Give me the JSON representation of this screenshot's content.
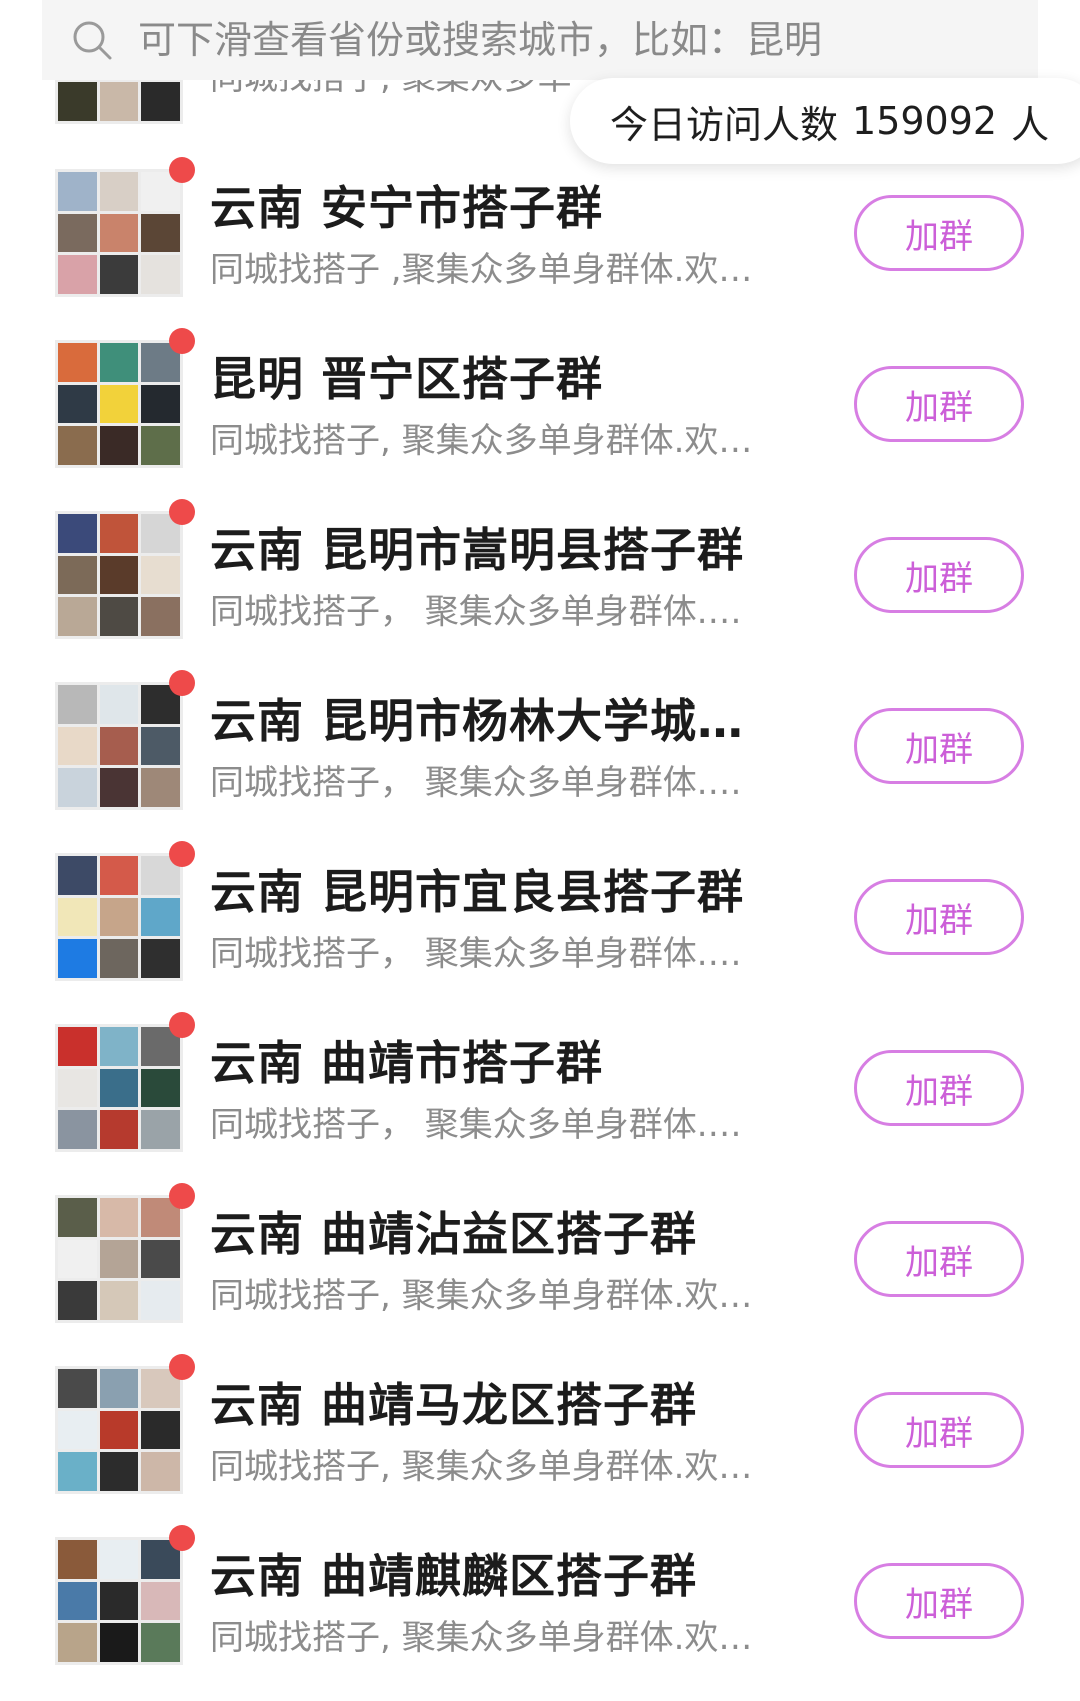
{
  "search": {
    "placeholder": "可下滑查看省份或搜索城市，比如：昆明"
  },
  "visitor": {
    "prefix": "今日访问人数",
    "count": "159092",
    "unit": "人"
  },
  "partial_row": {
    "subtitle": "同城找搭子, 聚集众多单"
  },
  "join_label": "加群",
  "colors": {
    "accent": "#cc5fd8",
    "button_border": "#d77ee3",
    "unread_dot": "#ee4a4a",
    "subtitle": "#8c8c8c"
  },
  "groups": [
    {
      "title": "云南 安宁市搭子群",
      "subtitle": "同城找搭子 ,聚集众多单身群体.欢迎加入",
      "avatar_colors": [
        "#9fb3c9",
        "#d8cfc6",
        "#f0f0f0",
        "#7a6a5e",
        "#c9836b",
        "#5b4636",
        "#d9a2a8",
        "#3b3b3b",
        "#e5e2de"
      ]
    },
    {
      "title": "昆明 晋宁区搭子群",
      "subtitle": "同城找搭子, 聚集众多单身群体.欢迎加入",
      "avatar_colors": [
        "#d96b3c",
        "#3f8f7a",
        "#6d7b86",
        "#2f3a46",
        "#f2d23a",
        "#24292f",
        "#8a6c4e",
        "#3a2a26",
        "#5e6e4a"
      ]
    },
    {
      "title": "云南 昆明市嵩明县搭子群",
      "subtitle": "同城找搭子，  聚集众多单身群体.欢迎加入",
      "avatar_colors": [
        "#3b4a7a",
        "#c0543a",
        "#d6d6d6",
        "#7c6a58",
        "#5a3b2a",
        "#e7ddd0",
        "#b9a896",
        "#4e4a44",
        "#8a7060"
      ]
    },
    {
      "title": "云南 昆明市杨林大学城搭子群",
      "subtitle": "同城找搭子，  聚集众多单身群体.欢迎加入",
      "avatar_colors": [
        "#b8b8b8",
        "#dfe6ea",
        "#2d2d2d",
        "#e8d9c8",
        "#a65d4e",
        "#4d5a66",
        "#c9d3dc",
        "#4a3434",
        "#9e8878"
      ]
    },
    {
      "title": "云南 昆明市宜良县搭子群",
      "subtitle": "同城找搭子，  聚集众多单身群体.欢迎加入",
      "avatar_colors": [
        "#3d4a66",
        "#d45a4a",
        "#d8d8d8",
        "#f1e7b8",
        "#c6a58a",
        "#5fa7c9",
        "#1e7be3",
        "#6d665e",
        "#2f2f2f"
      ]
    },
    {
      "title": "云南 曲靖市搭子群",
      "subtitle": "同城找搭子，  聚集众多单身群体.欢迎加入",
      "avatar_colors": [
        "#c9302c",
        "#7fb3c8",
        "#6a6a6a",
        "#e8e6e3",
        "#3a6e8a",
        "#2a4a3a",
        "#8a94a0",
        "#b63a2e",
        "#9aa3a8"
      ]
    },
    {
      "title": "云南 曲靖沾益区搭子群",
      "subtitle": "同城找搭子, 聚集众多单身群体.欢迎加入",
      "avatar_colors": [
        "#5a5e4a",
        "#d7b9a8",
        "#c08a78",
        "#f0f0f0",
        "#b4a496",
        "#4a4a4a",
        "#3a3a3a",
        "#d5c8b8",
        "#e6ebef"
      ]
    },
    {
      "title": "云南 曲靖马龙区搭子群",
      "subtitle": "同城找搭子, 聚集众多单身群体.欢迎加入",
      "avatar_colors": [
        "#4a4a4a",
        "#8aa0b0",
        "#d8c8bc",
        "#e8eef2",
        "#b83a2a",
        "#2a2a2a",
        "#6ab0c8",
        "#2c2c2c",
        "#cdb7a8"
      ]
    },
    {
      "title": "云南 曲靖麒麟区搭子群",
      "subtitle": "同城找搭子, 聚集众多单身群体.欢迎加入",
      "avatar_colors": [
        "#8a5a3a",
        "#e8eef2",
        "#3a4a5a",
        "#4a7aa8",
        "#2a2a2a",
        "#d8b8b8",
        "#b8a48a",
        "#1a1a1a",
        "#5a7a5a"
      ]
    }
  ]
}
